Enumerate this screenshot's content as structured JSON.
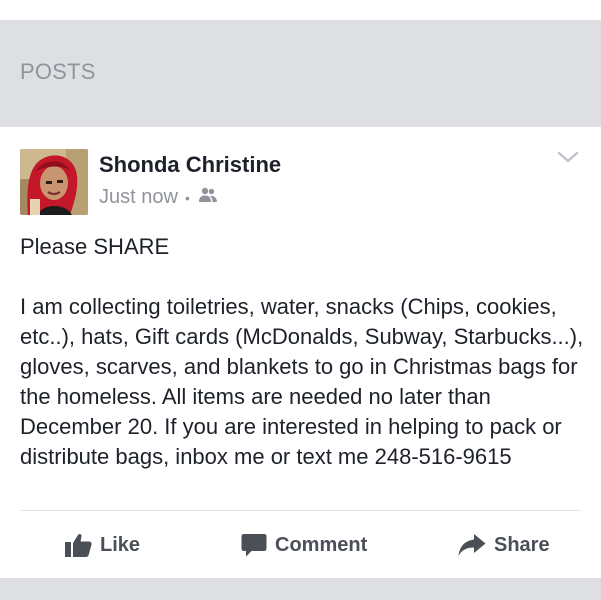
{
  "section": {
    "title": "POSTS"
  },
  "post": {
    "author": "Shonda Christine",
    "timestamp": "Just now",
    "separator": "•",
    "privacy_icon": "friends-icon",
    "menu_icon": "chevron-down-icon",
    "paragraphs": [
      "Please SHARE",
      "I am collecting toiletries, water, snacks (Chips, cookies, etc..), hats, Gift cards (McDonalds, Subway, Starbucks...), gloves, scarves, and blankets to go in Christmas bags for the homeless. All items are needed no later than December 20. If you are interested in helping to pack or distribute bags, inbox me or text me 248-516-9615"
    ]
  },
  "actions": {
    "like_label": "Like",
    "comment_label": "Comment",
    "share_label": "Share"
  },
  "colors": {
    "background": "#dddfe2",
    "card": "#ffffff",
    "text": "#1d2129",
    "muted": "#90949c",
    "action": "#4b4f56"
  }
}
